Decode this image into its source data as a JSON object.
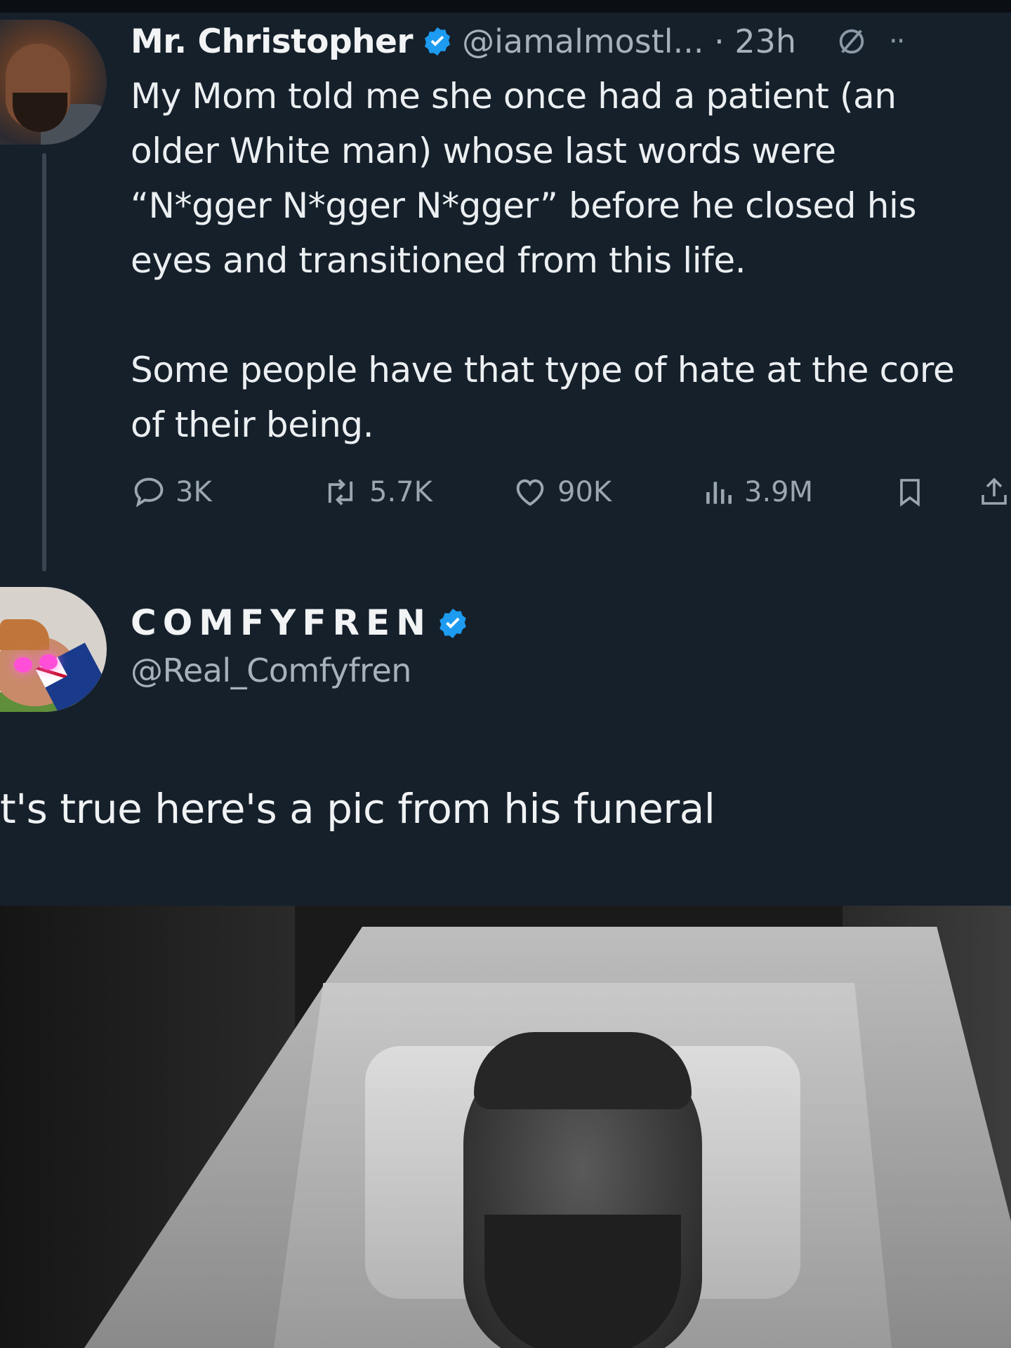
{
  "tweet": {
    "name": "Mr. Christopher",
    "handle_time": "@iamalmostl... · 23h",
    "text": "My Mom told me she once had a patient (an\nolder White man) whose last words were\n“N*gger N*gger N*gger” before he closed his\neyes and transitioned from this life.\n\nSome people have that type of hate at the core\nof their being.",
    "stats": {
      "replies": "3K",
      "reposts": "5.7K",
      "likes": "90K",
      "views": "3.9M"
    }
  },
  "reply": {
    "name": "COMFYFREN",
    "handle": "@Real_Comfyfren",
    "text": "t's true here's a pic from his funeral"
  },
  "colors": {
    "background": "#15202b",
    "verified": "#1d9bf0",
    "muted": "#8b98a5"
  },
  "icons": [
    "verified-badge-icon",
    "grok-icon",
    "more-icon",
    "reply-icon",
    "repost-icon",
    "like-icon",
    "views-icon",
    "bookmark-icon",
    "share-icon"
  ]
}
